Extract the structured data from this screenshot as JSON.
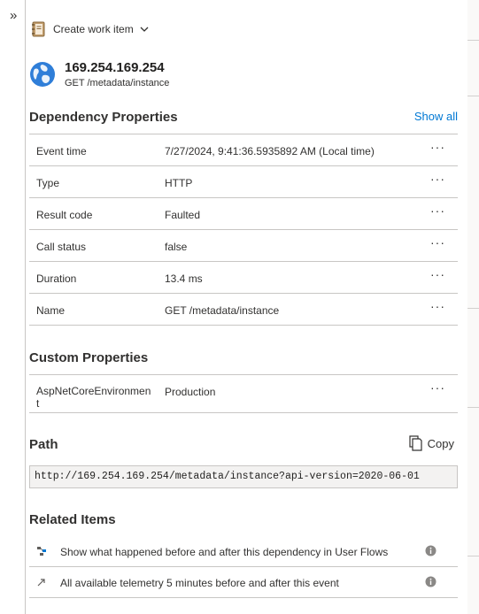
{
  "nav": {
    "expand_glyph": "»"
  },
  "toolbar": {
    "create_work_item": "Create work item",
    "icon": "notebook-icon"
  },
  "header": {
    "title": "169.254.169.254",
    "subtitle": "GET /metadata/instance",
    "icon": "globe-icon"
  },
  "dependency": {
    "title": "Dependency Properties",
    "show_all": "Show all",
    "rows": [
      {
        "key": "Event time",
        "value": "7/27/2024, 9:41:36.5935892 AM (Local time)"
      },
      {
        "key": "Type",
        "value": "HTTP"
      },
      {
        "key": "Result code",
        "value": "Faulted"
      },
      {
        "key": "Call status",
        "value": "false"
      },
      {
        "key": "Duration",
        "value": "13.4 ms"
      },
      {
        "key": "Name",
        "value": "GET /metadata/instance"
      }
    ],
    "more_glyph": "···"
  },
  "custom": {
    "title": "Custom Properties",
    "rows": [
      {
        "key": "AspNetCoreEnvironment",
        "value": "Production"
      }
    ]
  },
  "path": {
    "title": "Path",
    "copy_label": "Copy",
    "url": "http://169.254.169.254/metadata/instance?api-version=2020-06-01"
  },
  "related": {
    "title": "Related Items",
    "items": [
      {
        "label": "Show what happened before and after this dependency in User Flows",
        "icon": "user-flows-icon"
      },
      {
        "label": "All available telemetry 5 minutes before and after this event",
        "icon": "arrow-up-right-icon"
      }
    ]
  },
  "colors": {
    "accent": "#0078d4",
    "border": "#c8c6c4",
    "globe": "#2f7ed8"
  }
}
